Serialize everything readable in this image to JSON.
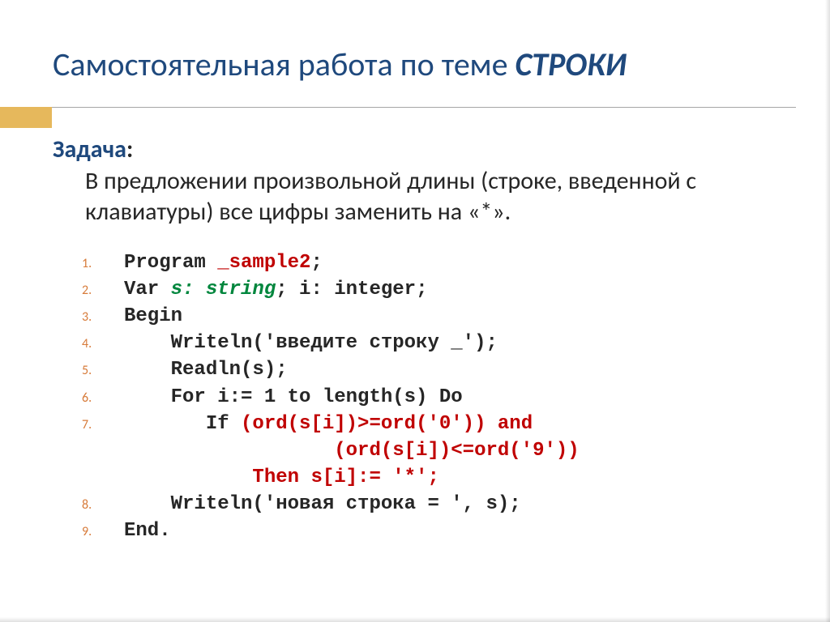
{
  "title": {
    "main": "Самостоятельная работа по теме ",
    "emph": "СТРОКИ"
  },
  "task": {
    "label": "Задача",
    "colon": ":",
    "text": "В предложении произвольной длины (строке, введенной с клавиатуры) все цифры заменить на «*»."
  },
  "code": {
    "l1_a": "Program ",
    "l1_b": "_sample2",
    "l1_c": ";",
    "l2_a": "Var ",
    "l2_b": "s: string",
    "l2_c": "; i: integer;",
    "l3": "Begin",
    "l4": "    Writeln('введите строку _');",
    "l5": "    Readln(s);",
    "l6": "    For i:= 1 to length(s) Do",
    "l7a": "       If ",
    "l7b": "(ord(s[i])>=ord('0')) and",
    "l7c": "                  (ord(s[i])<=ord('9'))",
    "l7d": "           Then s[i]:= '*';",
    "l8": "    Writeln('новая строка = ', s);",
    "l9": "End."
  },
  "nums": {
    "n1": "1.",
    "n2": "2.",
    "n3": "3.",
    "n4": "4.",
    "n5": "5.",
    "n6": "6.",
    "n7": "7.",
    "n8": "8.",
    "n9": "9."
  }
}
